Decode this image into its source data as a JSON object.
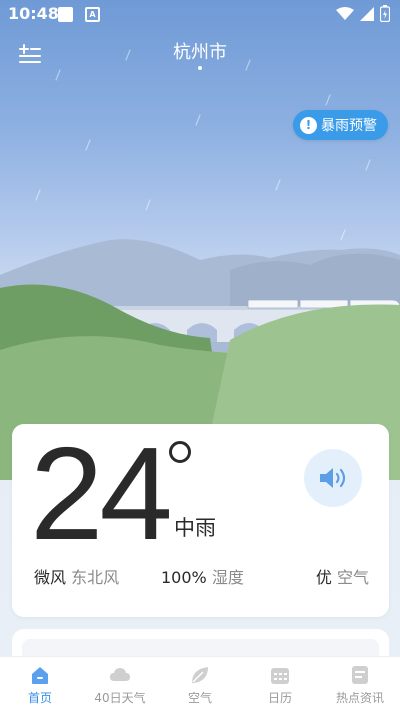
{
  "status_bar": {
    "time": "10:48",
    "notif_2_glyph": "A"
  },
  "header": {
    "city": "杭州市"
  },
  "alert": {
    "label": "暴雨预警",
    "icon_glyph": "!"
  },
  "weather": {
    "temperature": "24",
    "condition": "中雨",
    "wind_value": "微风",
    "wind_label": "东北风",
    "humidity_value": "100%",
    "humidity_label": "湿度",
    "air_value": "优",
    "air_label": "空气"
  },
  "tabs": [
    {
      "label": "首页",
      "icon": "home-icon",
      "active": true
    },
    {
      "label": "40日天气",
      "icon": "cloud-icon",
      "active": false
    },
    {
      "label": "空气",
      "icon": "leaf-icon",
      "active": false
    },
    {
      "label": "日历",
      "icon": "calendar-icon",
      "active": false
    },
    {
      "label": "热点资讯",
      "icon": "news-icon",
      "active": false
    }
  ],
  "colors": {
    "accent": "#3a8fe6",
    "alert_bg": "#3a9be8",
    "sky_top": "#6f9ad6"
  }
}
